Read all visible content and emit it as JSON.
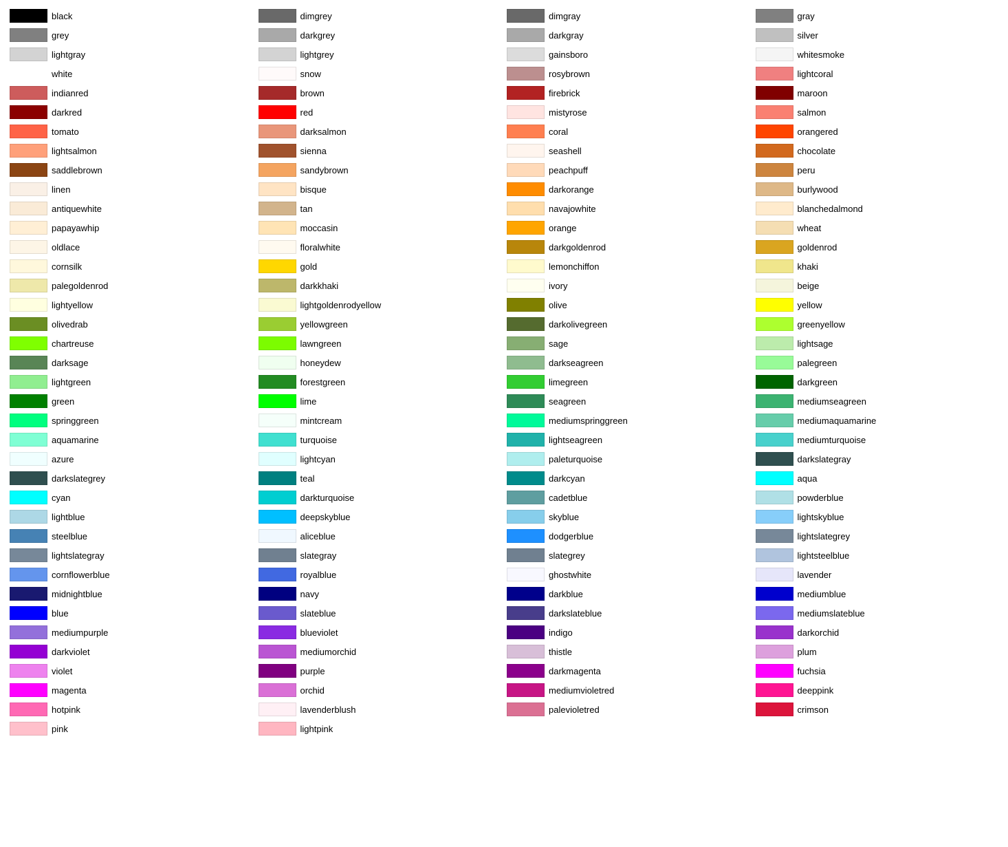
{
  "colors": [
    [
      {
        "name": "black",
        "hex": "#000000"
      },
      {
        "name": "grey",
        "hex": "#808080"
      },
      {
        "name": "lightgray",
        "hex": "#d3d3d3"
      },
      {
        "name": "white",
        "hex": null
      },
      {
        "name": "indianred",
        "hex": "#cd5c5c"
      },
      {
        "name": "darkred",
        "hex": "#8b0000"
      },
      {
        "name": "tomato",
        "hex": "#ff6347"
      },
      {
        "name": "lightsalmon",
        "hex": "#ffa07a"
      },
      {
        "name": "saddlebrown",
        "hex": "#8b4513"
      },
      {
        "name": "linen",
        "hex": "#faf0e6"
      },
      {
        "name": "antiquewhite",
        "hex": "#faebd7"
      },
      {
        "name": "papayawhip",
        "hex": "#ffefd5"
      },
      {
        "name": "oldlace",
        "hex": "#fdf5e6"
      },
      {
        "name": "cornsilk",
        "hex": "#fff8dc"
      },
      {
        "name": "palegoldenrod",
        "hex": "#eee8aa"
      },
      {
        "name": "lightyellow",
        "hex": "#ffffe0"
      },
      {
        "name": "olivedrab",
        "hex": "#6b8e23"
      },
      {
        "name": "chartreuse",
        "hex": "#7fff00"
      },
      {
        "name": "darksage",
        "hex": "#598556"
      },
      {
        "name": "lightgreen",
        "hex": "#90ee90"
      },
      {
        "name": "green",
        "hex": "#008000"
      },
      {
        "name": "springgreen",
        "hex": "#00ff7f"
      },
      {
        "name": "aquamarine",
        "hex": "#7fffd4"
      },
      {
        "name": "azure",
        "hex": "#f0ffff"
      },
      {
        "name": "darkslategrey",
        "hex": "#2f4f4f"
      },
      {
        "name": "cyan",
        "hex": "#00ffff"
      },
      {
        "name": "lightblue",
        "hex": "#add8e6"
      },
      {
        "name": "steelblue",
        "hex": "#4682b4"
      },
      {
        "name": "lightslategray",
        "hex": "#778899"
      },
      {
        "name": "cornflowerblue",
        "hex": "#6495ed"
      },
      {
        "name": "midnightblue",
        "hex": "#191970"
      },
      {
        "name": "blue",
        "hex": "#0000ff"
      },
      {
        "name": "mediumpurple",
        "hex": "#9370db"
      },
      {
        "name": "darkviolet",
        "hex": "#9400d3"
      },
      {
        "name": "violet",
        "hex": "#ee82ee"
      },
      {
        "name": "magenta",
        "hex": "#ff00ff"
      },
      {
        "name": "hotpink",
        "hex": "#ff69b4"
      },
      {
        "name": "pink",
        "hex": "#ffc0cb"
      }
    ],
    [
      {
        "name": "dimgrey",
        "hex": "#696969"
      },
      {
        "name": "darkgrey",
        "hex": "#a9a9a9"
      },
      {
        "name": "lightgrey",
        "hex": "#d3d3d3"
      },
      {
        "name": "snow",
        "hex": "#fffafa"
      },
      {
        "name": "brown",
        "hex": "#a52a2a"
      },
      {
        "name": "red",
        "hex": "#ff0000"
      },
      {
        "name": "darksalmon",
        "hex": "#e9967a"
      },
      {
        "name": "sienna",
        "hex": "#a0522d"
      },
      {
        "name": "sandybrown",
        "hex": "#f4a460"
      },
      {
        "name": "bisque",
        "hex": "#ffe4c4"
      },
      {
        "name": "tan",
        "hex": "#d2b48c"
      },
      {
        "name": "moccasin",
        "hex": "#ffe4b5"
      },
      {
        "name": "floralwhite",
        "hex": "#fffaf0"
      },
      {
        "name": "gold",
        "hex": "#ffd700"
      },
      {
        "name": "darkkhaki",
        "hex": "#bdb76b"
      },
      {
        "name": "lightgoldenrodyellow",
        "hex": "#fafad2"
      },
      {
        "name": "yellowgreen",
        "hex": "#9acd32"
      },
      {
        "name": "lawngreen",
        "hex": "#7cfc00"
      },
      {
        "name": "honeydew",
        "hex": "#f0fff0"
      },
      {
        "name": "forestgreen",
        "hex": "#228b22"
      },
      {
        "name": "lime",
        "hex": "#00ff00"
      },
      {
        "name": "mintcream",
        "hex": "#f5fffa"
      },
      {
        "name": "turquoise",
        "hex": "#40e0d0"
      },
      {
        "name": "lightcyan",
        "hex": "#e0ffff"
      },
      {
        "name": "teal",
        "hex": "#008080"
      },
      {
        "name": "darkturquoise",
        "hex": "#00ced1"
      },
      {
        "name": "deepskyblue",
        "hex": "#00bfff"
      },
      {
        "name": "aliceblue",
        "hex": "#f0f8ff"
      },
      {
        "name": "slategray",
        "hex": "#708090"
      },
      {
        "name": "royalblue",
        "hex": "#4169e1"
      },
      {
        "name": "navy",
        "hex": "#000080"
      },
      {
        "name": "slateblue",
        "hex": "#6a5acd"
      },
      {
        "name": "blueviolet",
        "hex": "#8a2be2"
      },
      {
        "name": "mediumorchid",
        "hex": "#ba55d3"
      },
      {
        "name": "purple",
        "hex": "#800080"
      },
      {
        "name": "orchid",
        "hex": "#da70d6"
      },
      {
        "name": "lavenderblush",
        "hex": "#fff0f5"
      },
      {
        "name": "lightpink",
        "hex": "#ffb6c1"
      }
    ],
    [
      {
        "name": "dimgray",
        "hex": "#696969"
      },
      {
        "name": "darkgray",
        "hex": "#a9a9a9"
      },
      {
        "name": "gainsboro",
        "hex": "#dcdcdc"
      },
      {
        "name": "rosybrown",
        "hex": "#bc8f8f"
      },
      {
        "name": "firebrick",
        "hex": "#b22222"
      },
      {
        "name": "mistyrose",
        "hex": "#ffe4e1"
      },
      {
        "name": "coral",
        "hex": "#ff7f50"
      },
      {
        "name": "seashell",
        "hex": "#fff5ee"
      },
      {
        "name": "peachpuff",
        "hex": "#ffdab9"
      },
      {
        "name": "darkorange",
        "hex": "#ff8c00"
      },
      {
        "name": "navajowhite",
        "hex": "#ffdead"
      },
      {
        "name": "orange",
        "hex": "#ffa500"
      },
      {
        "name": "darkgoldenrod",
        "hex": "#b8860b"
      },
      {
        "name": "lemonchiffon",
        "hex": "#fffacd"
      },
      {
        "name": "ivory",
        "hex": "#fffff0"
      },
      {
        "name": "olive",
        "hex": "#808000"
      },
      {
        "name": "darkolivegreen",
        "hex": "#556b2f"
      },
      {
        "name": "sage",
        "hex": "#87ae73"
      },
      {
        "name": "darkseagreen",
        "hex": "#8fbc8f"
      },
      {
        "name": "limegreen",
        "hex": "#32cd32"
      },
      {
        "name": "seagreen",
        "hex": "#2e8b57"
      },
      {
        "name": "mediumspringgreen",
        "hex": "#00fa9a"
      },
      {
        "name": "lightseagreen",
        "hex": "#20b2aa"
      },
      {
        "name": "paleturquoise",
        "hex": "#afeeee"
      },
      {
        "name": "darkcyan",
        "hex": "#008b8b"
      },
      {
        "name": "cadetblue",
        "hex": "#5f9ea0"
      },
      {
        "name": "skyblue",
        "hex": "#87ceeb"
      },
      {
        "name": "dodgerblue",
        "hex": "#1e90ff"
      },
      {
        "name": "slategrey",
        "hex": "#708090"
      },
      {
        "name": "ghostwhite",
        "hex": "#f8f8ff"
      },
      {
        "name": "darkblue",
        "hex": "#00008b"
      },
      {
        "name": "darkslateblue",
        "hex": "#483d8b"
      },
      {
        "name": "indigo",
        "hex": "#4b0082"
      },
      {
        "name": "thistle",
        "hex": "#d8bfd8"
      },
      {
        "name": "darkmagenta",
        "hex": "#8b008b"
      },
      {
        "name": "mediumvioletred",
        "hex": "#c71585"
      },
      {
        "name": "palevioletred",
        "hex": "#db7093"
      }
    ],
    [
      {
        "name": "gray",
        "hex": "#808080"
      },
      {
        "name": "silver",
        "hex": "#c0c0c0"
      },
      {
        "name": "whitesmoke",
        "hex": "#f5f5f5"
      },
      {
        "name": "lightcoral",
        "hex": "#f08080"
      },
      {
        "name": "maroon",
        "hex": "#800000"
      },
      {
        "name": "salmon",
        "hex": "#fa8072"
      },
      {
        "name": "orangered",
        "hex": "#ff4500"
      },
      {
        "name": "chocolate",
        "hex": "#d2691e"
      },
      {
        "name": "peru",
        "hex": "#cd853f"
      },
      {
        "name": "burlywood",
        "hex": "#deb887"
      },
      {
        "name": "blanchedalmond",
        "hex": "#ffebcd"
      },
      {
        "name": "wheat",
        "hex": "#f5deb3"
      },
      {
        "name": "goldenrod",
        "hex": "#daa520"
      },
      {
        "name": "khaki",
        "hex": "#f0e68c"
      },
      {
        "name": "beige",
        "hex": "#f5f5dc"
      },
      {
        "name": "yellow",
        "hex": "#ffff00"
      },
      {
        "name": "greenyellow",
        "hex": "#adff2f"
      },
      {
        "name": "lightsage",
        "hex": "#bcecac"
      },
      {
        "name": "palegreen",
        "hex": "#98fb98"
      },
      {
        "name": "darkgreen",
        "hex": "#006400"
      },
      {
        "name": "mediumseagreen",
        "hex": "#3cb371"
      },
      {
        "name": "mediumaquamarine",
        "hex": "#66cdaa"
      },
      {
        "name": "mediumturquoise",
        "hex": "#48d1cc"
      },
      {
        "name": "darkslategray",
        "hex": "#2f4f4f"
      },
      {
        "name": "aqua",
        "hex": "#00ffff"
      },
      {
        "name": "powderblue",
        "hex": "#b0e0e6"
      },
      {
        "name": "lightskyblue",
        "hex": "#87cefa"
      },
      {
        "name": "lightslategrey",
        "hex": "#778899"
      },
      {
        "name": "lightsteelblue",
        "hex": "#b0c4de"
      },
      {
        "name": "lavender",
        "hex": "#e6e6fa"
      },
      {
        "name": "mediumblue",
        "hex": "#0000cd"
      },
      {
        "name": "mediumslateblue",
        "hex": "#7b68ee"
      },
      {
        "name": "darkorchid",
        "hex": "#9932cc"
      },
      {
        "name": "plum",
        "hex": "#dda0dd"
      },
      {
        "name": "fuchsia",
        "hex": "#ff00ff"
      },
      {
        "name": "deeppink",
        "hex": "#ff1493"
      },
      {
        "name": "crimson",
        "hex": "#dc143c"
      }
    ]
  ]
}
